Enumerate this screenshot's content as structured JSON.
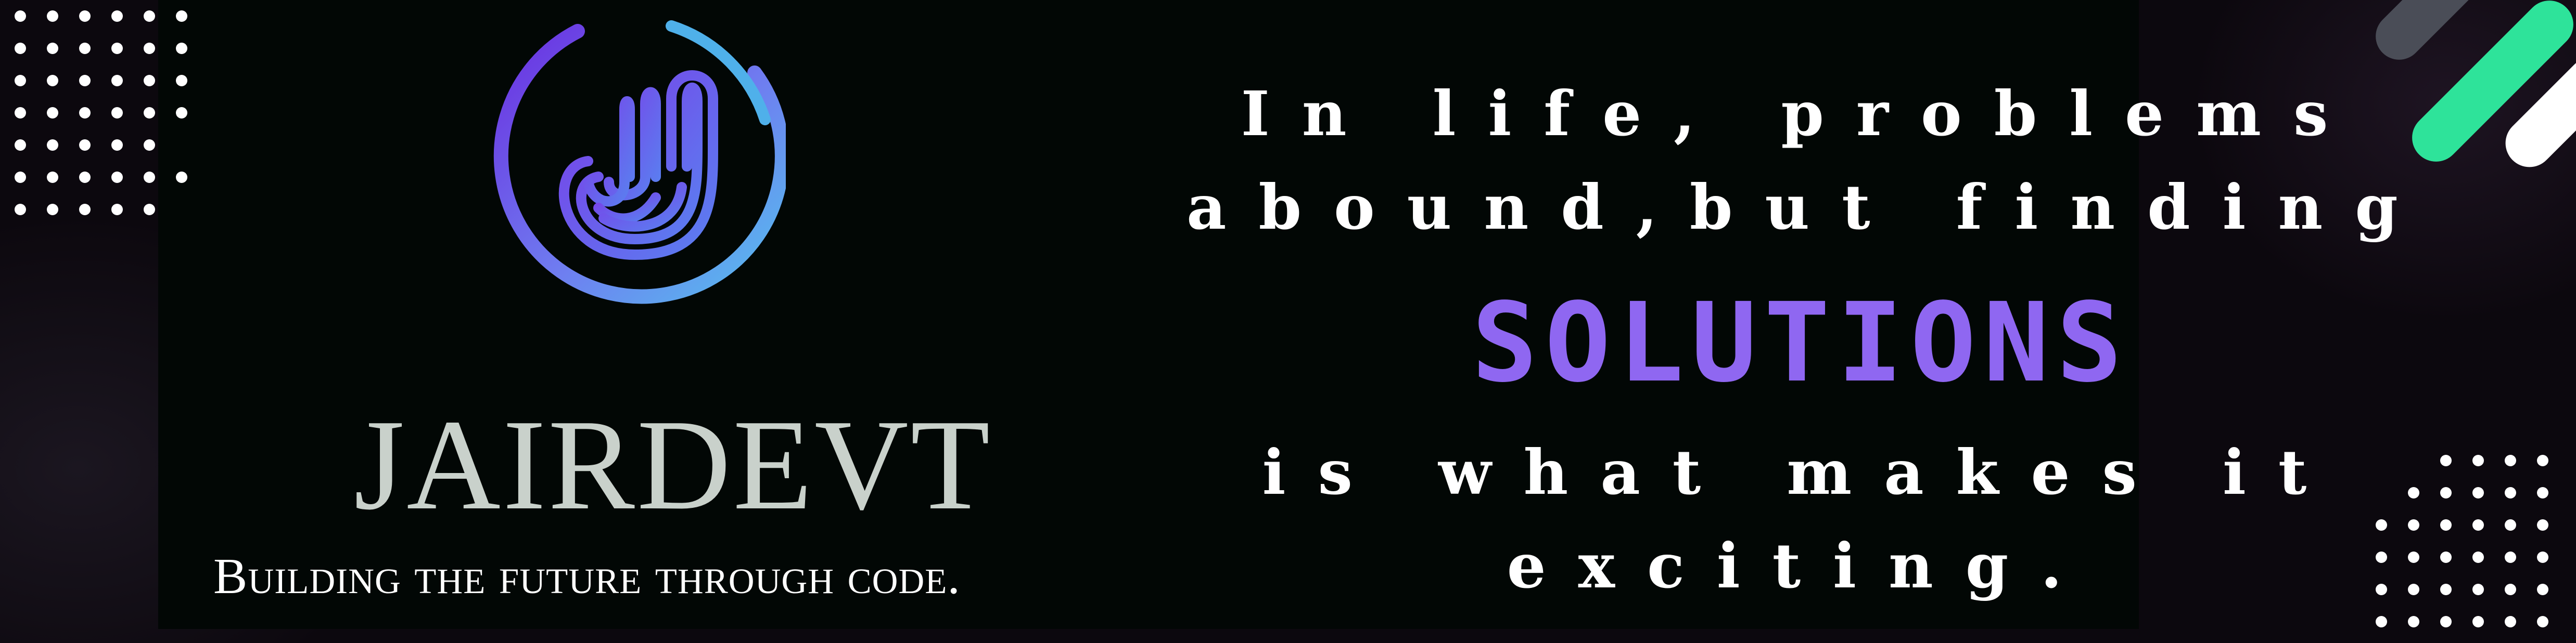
{
  "brand": {
    "name": "JAIRDEVT",
    "tagline": "Building the future through code."
  },
  "quote": {
    "line1": "In life, problems",
    "line2": "abound,but finding",
    "highlight": "SOLUTIONS",
    "line3": "is what makes it",
    "line4": "exciting."
  },
  "colors": {
    "accent": "#8f67f1",
    "stripe_green": "#2ee39a",
    "stripe_gray": "#4a4d57",
    "panel": "#020705"
  },
  "icons": [
    "j-logo-icon",
    "dot-grid-icon",
    "diagonal-stripes-icon"
  ]
}
